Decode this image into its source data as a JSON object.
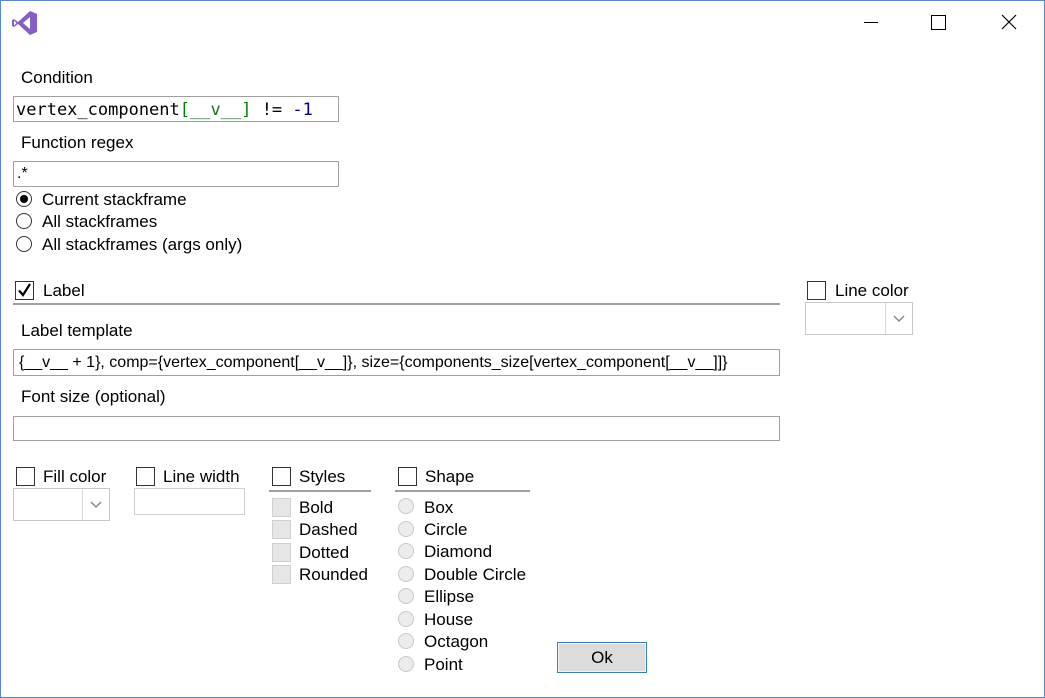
{
  "app": {
    "icon": "visual-studio-icon"
  },
  "titlebar": {
    "minimize_icon": "minimize-icon",
    "maximize_icon": "maximize-icon",
    "close_icon": "close-icon"
  },
  "condition": {
    "label": "Condition",
    "value_parts": [
      "vertex_component",
      "[",
      "__v__",
      "]",
      " != ",
      "-1"
    ]
  },
  "function_regex": {
    "label": "Function regex",
    "value": ".*",
    "options": [
      "Current stackframe",
      "All stackframes",
      "All stackframes (args only)"
    ],
    "selected": "Current stackframe"
  },
  "label_section": {
    "label": "Label",
    "checked": true
  },
  "line_color": {
    "label": "Line color",
    "checked": false,
    "value": ""
  },
  "label_template": {
    "label": "Label template",
    "value": "{__v__ + 1}, comp={vertex_component[__v__]}, size={components_size[vertex_component[__v__]]}"
  },
  "font_size": {
    "label": "Font size (optional)",
    "value": ""
  },
  "fill_color": {
    "label": "Fill color",
    "checked": false,
    "value": ""
  },
  "line_width": {
    "label": "Line width",
    "checked": false,
    "value": ""
  },
  "styles": {
    "label": "Styles",
    "checked": false,
    "options": [
      "Bold",
      "Dashed",
      "Dotted",
      "Rounded"
    ]
  },
  "shape": {
    "label": "Shape",
    "checked": false,
    "options": [
      "Box",
      "Circle",
      "Diamond",
      "Double Circle",
      "Ellipse",
      "House",
      "Octagon",
      "Point"
    ]
  },
  "ok_button": {
    "label": "Ok"
  },
  "colors": {
    "code_identifier": "#000000",
    "code_bracket": "#008000",
    "code_param": "#1f6f1f",
    "code_number": "#000080",
    "accent": "#3c7fb1"
  }
}
